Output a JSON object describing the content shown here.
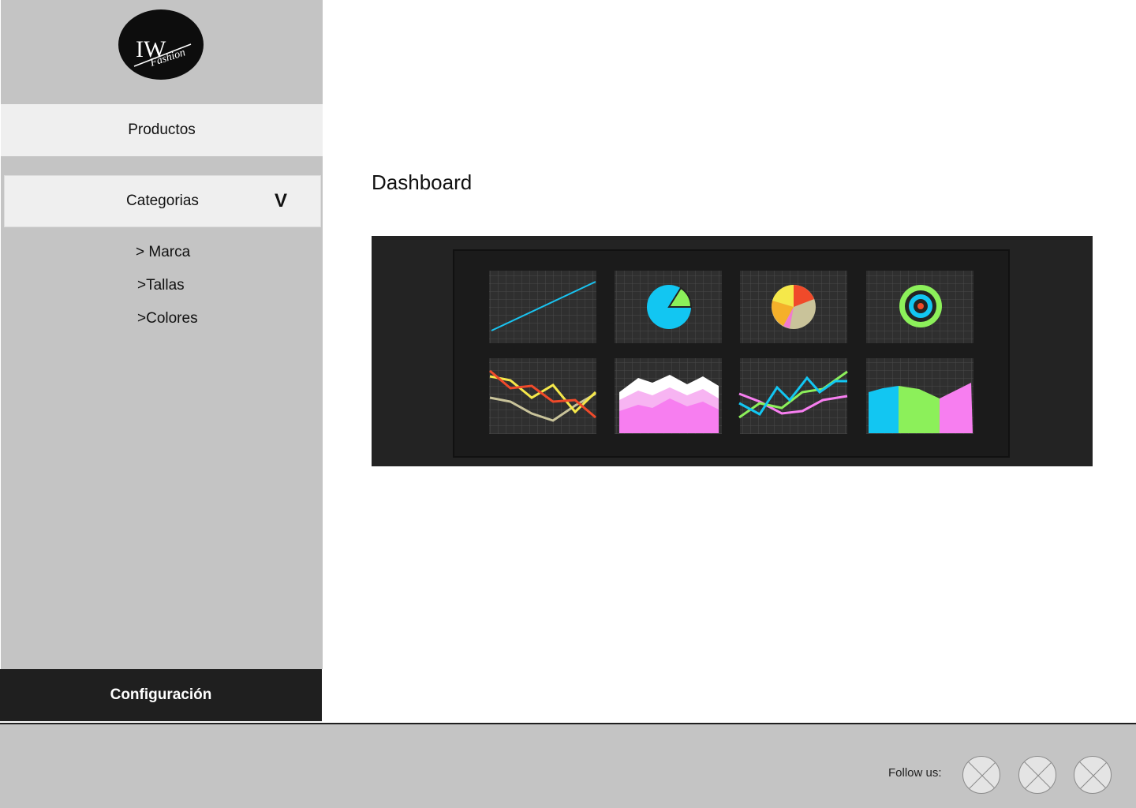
{
  "logo": {
    "text": "IW",
    "subtext": "Fashion"
  },
  "sidebar": {
    "productos": "Productos",
    "categorias": "Categorias",
    "categorias_chevron": "V",
    "subitems": [
      "> Marca",
      ">Tallas",
      ">Colores"
    ],
    "config": "Configuración"
  },
  "main": {
    "title": "Dashboard"
  },
  "footer": {
    "follow": "Follow us:"
  },
  "colors": {
    "sidebar": "#c4c4c4",
    "active_item": "#efefef",
    "config_bg": "#1f1f1f",
    "panel_bg": "#232323"
  }
}
